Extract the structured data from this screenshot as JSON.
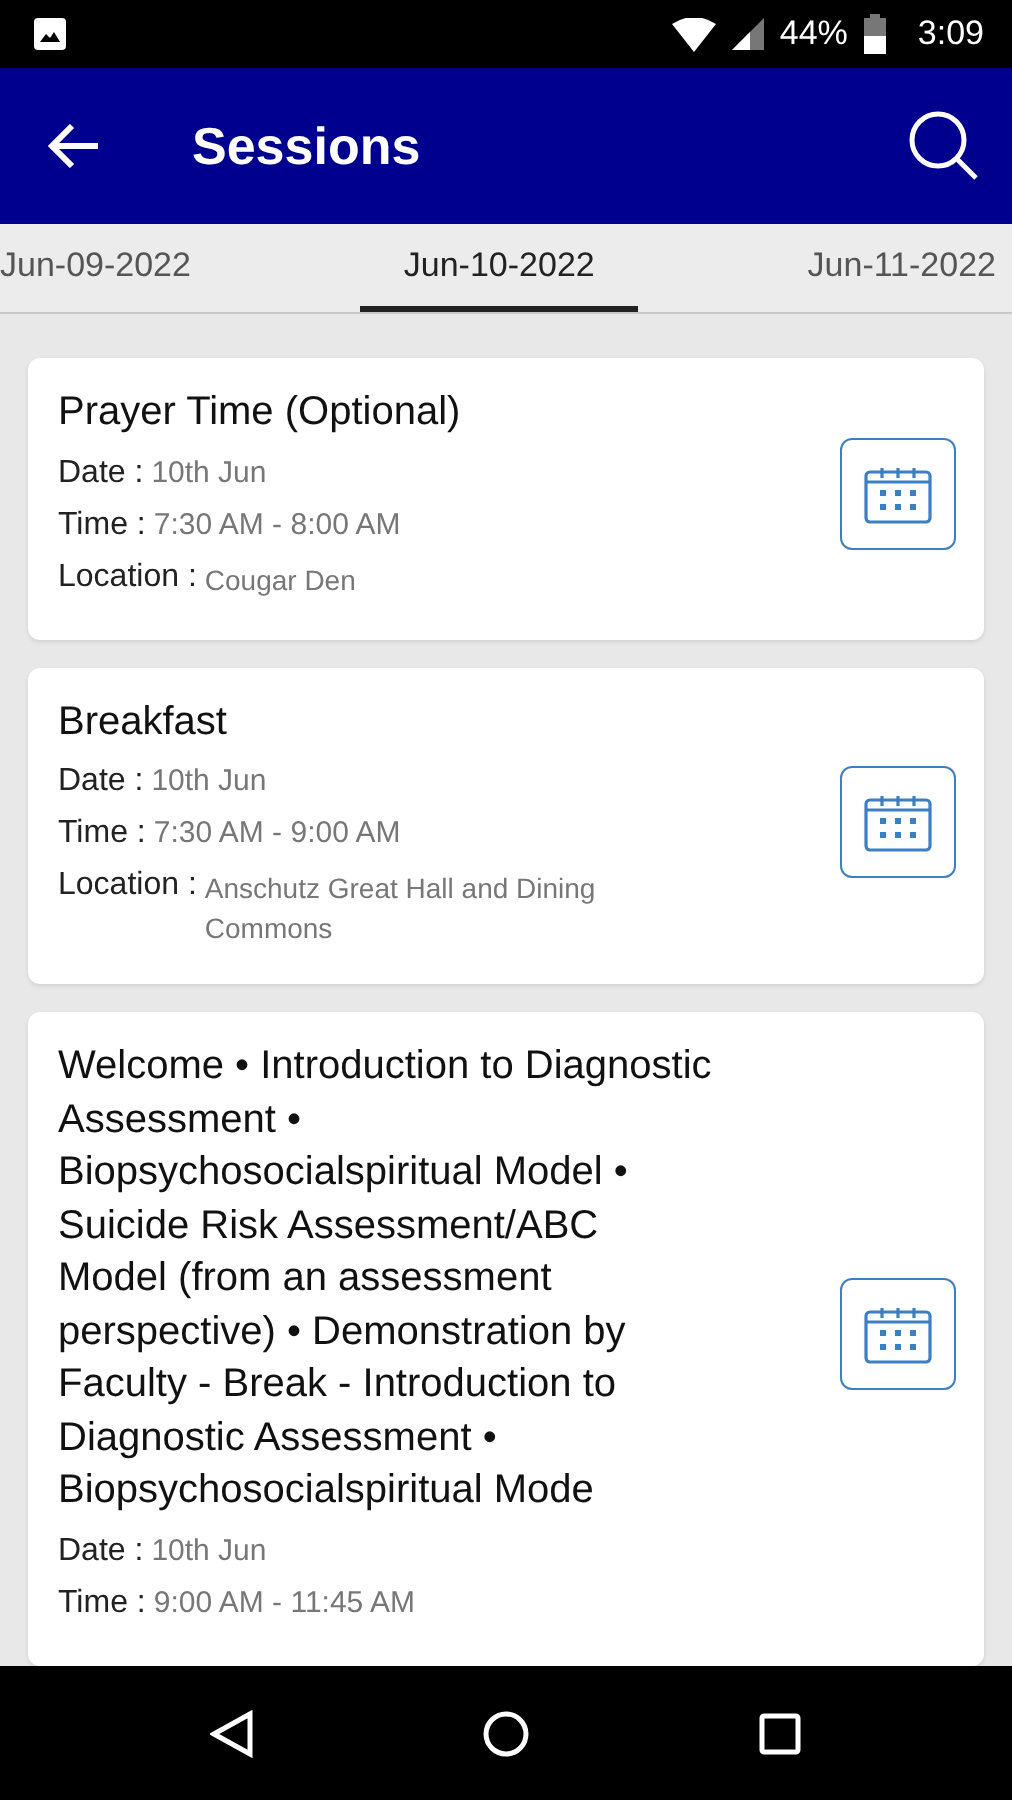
{
  "status_bar": {
    "battery": "44%",
    "time": "3:09"
  },
  "app_bar": {
    "title": "Sessions"
  },
  "tabs": [
    {
      "label": "Jun-09-2022",
      "selected": false
    },
    {
      "label": "Jun-10-2022",
      "selected": true
    },
    {
      "label": "Jun-11-2022",
      "selected": false
    }
  ],
  "sessions": [
    {
      "title": "Prayer Time (Optional)",
      "date_label": "Date :",
      "date": "10th Jun",
      "time_label": "Time :",
      "time": "7:30 AM - 8:00 AM",
      "location_label": "Location :",
      "location": "Cougar Den"
    },
    {
      "title": "Breakfast",
      "date_label": "Date :",
      "date": "10th Jun",
      "time_label": "Time :",
      "time": "7:30 AM - 9:00 AM",
      "location_label": "Location :",
      "location": "Anschutz Great Hall and Dining Commons"
    },
    {
      "title": "Welcome • Introduction to Diagnostic Assessment • Biopsychosocialspiritual Model • Suicide Risk Assessment/ABC Model (from an assessment perspective) • Demonstration by Faculty - Break - Introduction to Diagnostic Assessment • Biopsychosocialspiritual Mode",
      "date_label": "Date :",
      "date": "10th Jun",
      "time_label": "Time :",
      "time": "9:00 AM - 11:45 AM"
    }
  ]
}
